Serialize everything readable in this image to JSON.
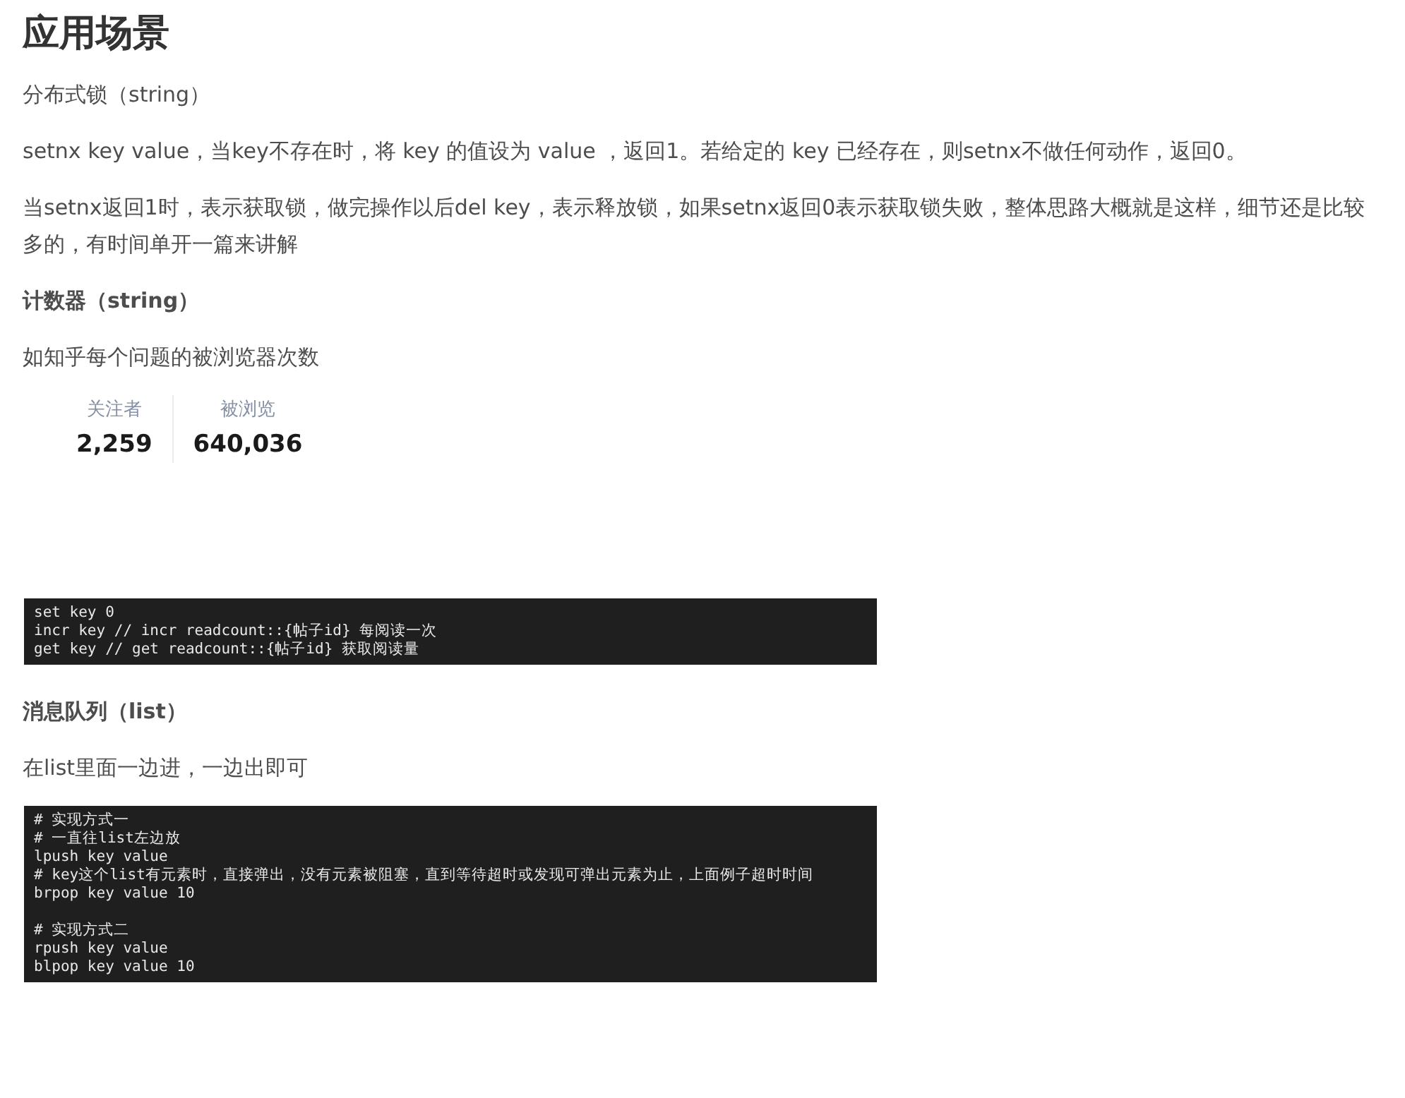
{
  "blocks": [
    {
      "kind": "heading",
      "text": "应用场景"
    },
    {
      "kind": "paragraph",
      "text": "分布式锁（string）"
    },
    {
      "kind": "paragraph",
      "text": "setnx key value，当key不存在时，将 key 的值设为 value ，返回1。若给定的 key 已经存在，则setnx不做任何动作，返回0。"
    },
    {
      "kind": "paragraph",
      "text": "当setnx返回1时，表示获取锁，做完操作以后del key，表示释放锁，如果setnx返回0表示获取锁失败，整体思路大概就是这样，细节还是比较多的，有时间单开一篇来讲解"
    },
    {
      "kind": "subheading",
      "text": "计数器（string）"
    },
    {
      "kind": "paragraph",
      "text": "如知乎每个问题的被浏览器次数"
    },
    {
      "kind": "stats",
      "items": [
        {
          "label": "关注者",
          "value": "2,259"
        },
        {
          "label": "被浏览",
          "value": "640,036"
        }
      ]
    },
    {
      "kind": "code",
      "groups": [
        [
          "set key 0",
          "incr key // incr readcount::{帖子id} 每阅读一次",
          "get key // get readcount::{帖子id} 获取阅读量"
        ]
      ]
    },
    {
      "kind": "subheading",
      "text": "消息队列（list）"
    },
    {
      "kind": "paragraph",
      "text": "在list里面一边进，一边出即可"
    },
    {
      "kind": "code",
      "groups": [
        [
          "# 实现方式一",
          "# 一直往list左边放",
          "lpush key value",
          "# key这个list有元素时，直接弹出，没有元素被阻塞，直到等待超时或发现可弹出元素为止，上面例子超时时间",
          "brpop key value 10"
        ],
        [
          "# 实现方式二",
          "rpush key value",
          "blpop key value 10"
        ]
      ]
    }
  ]
}
